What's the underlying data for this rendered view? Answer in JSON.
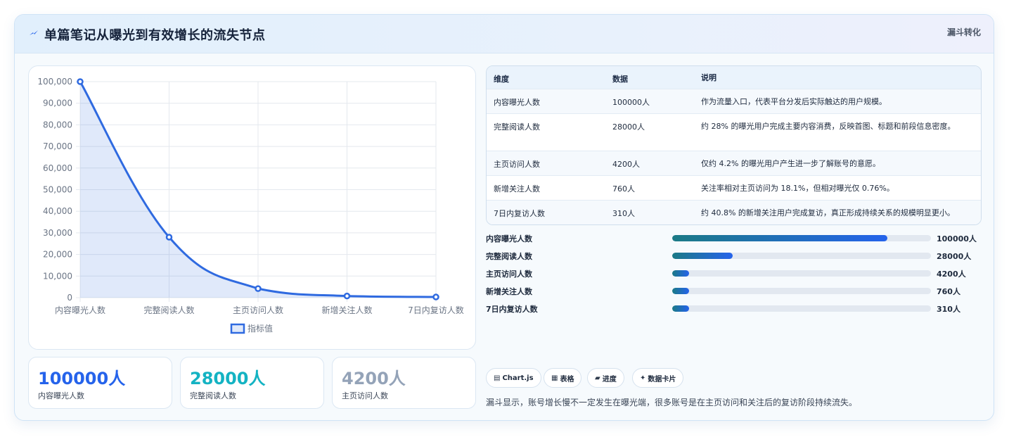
{
  "header": {
    "icon": "lightning-icon",
    "title": "单篇笔记从曝光到有效增长的流失节点",
    "tag": "漏斗转化"
  },
  "chart_data": {
    "type": "line",
    "categories": [
      "内容曝光人数",
      "完整阅读人数",
      "主页访问人数",
      "新增关注人数",
      "7日内复访人数"
    ],
    "series": [
      {
        "name": "指标值",
        "values": [
          100000,
          28000,
          4200,
          760,
          310
        ]
      }
    ],
    "y_ticks": [
      "100,000",
      "90,000",
      "80,000",
      "70,000",
      "60,000",
      "50,000",
      "40,000",
      "30,000",
      "20,000",
      "10,000",
      "0"
    ],
    "ylim": [
      0,
      100000
    ],
    "fill": true,
    "grid": true,
    "legend": "bottom",
    "color": "#2f6ae0"
  },
  "stats": [
    {
      "value": "100000人",
      "label": "内容曝光人数",
      "color": "#2563eb"
    },
    {
      "value": "28000人",
      "label": "完整阅读人数",
      "color": "#14b3c3"
    },
    {
      "value": "4200人",
      "label": "主页访问人数",
      "color": "#94a3b8"
    }
  ],
  "table": {
    "headers": [
      "维度",
      "数据",
      "说明"
    ],
    "rows": [
      {
        "dim": "内容曝光人数",
        "data": "100000人",
        "desc": "作为流量入口，代表平台分发后实际触达的用户规模。"
      },
      {
        "dim": "完整阅读人数",
        "data": "28000人",
        "desc": "约 28% 的曝光用户完成主要内容消费，反映首图、标题和前段信息密度。"
      },
      {
        "dim": "主页访问人数",
        "data": "4200人",
        "desc": "仅约 4.2% 的曝光用户产生进一步了解账号的意愿。"
      },
      {
        "dim": "新增关注人数",
        "data": "760人",
        "desc": "关注率相对主页访问为 18.1%，但相对曝光仅 0.76%。"
      },
      {
        "dim": "7日内复访人数",
        "data": "310人",
        "desc": "约 40.8% 的新增关注用户完成复访，真正形成持续关系的规模明显更小。"
      }
    ]
  },
  "progress": [
    {
      "label": "内容曝光人数",
      "value": "100000人",
      "fraction": 0.832
    },
    {
      "label": "完整阅读人数",
      "value": "28000人",
      "fraction": 0.233
    },
    {
      "label": "主页访问人数",
      "value": "4200人",
      "fraction": 0.065
    },
    {
      "label": "新增关注人数",
      "value": "760人",
      "fraction": 0.065
    },
    {
      "label": "7日内复访人数",
      "value": "310人",
      "fraction": 0.065
    }
  ],
  "chips": [
    {
      "icon": "chart-icon",
      "glyph": "▤",
      "label": "Chart.js"
    },
    {
      "icon": "table-icon",
      "glyph": "▦",
      "label": "表格"
    },
    {
      "icon": "progress-icon",
      "glyph": "▰",
      "label": "进度"
    },
    {
      "icon": "sparkle-icon",
      "glyph": "✦",
      "label": "数据卡片"
    }
  ],
  "note": "漏斗显示，账号增长慢不一定发生在曝光端，很多账号是在主页访问和关注后的复访阶段持续流失。"
}
